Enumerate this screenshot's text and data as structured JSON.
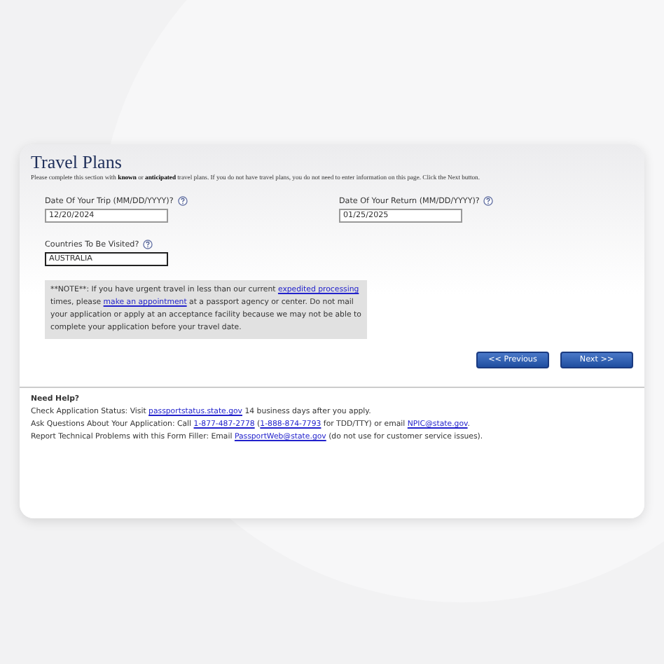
{
  "title": "Travel Plans",
  "description": "Please complete this section with **known** or **anticipated** travel plans. If you do not have travel plans, you do not need to enter information on this page. Click the Next button.",
  "date_fields": [
    {
      "label": "Date Of Your Trip (MM/DD/YYYY)?",
      "value": "12/20/2024"
    },
    {
      "label": "Date Of Your Return (MM/DD/YYYY)?",
      "value": "01/25/2025"
    }
  ],
  "countries_field": {
    "label": "Countries To Be Visited?",
    "value": "AUSTRALIA",
    "focused": true
  },
  "note": [
    {
      "kind": "text",
      "text": "**NOTE**: If you have urgent travel in less than our current "
    },
    {
      "kind": "link",
      "text": "expedited processing"
    },
    {
      "kind": "text",
      "text": " times, please "
    },
    {
      "kind": "link",
      "text": "make an appointment"
    },
    {
      "kind": "text",
      "text": " at a passport agency or center. Do not mail your application or apply at an acceptance facility because we may not be able to complete your application before your travel date."
    }
  ],
  "buttons": [
    "<< Previous",
    "Next >>"
  ],
  "help": {
    "title": "Need Help?",
    "lines": [
      [
        {
          "kind": "text",
          "text": "Check Application Status: Visit "
        },
        {
          "kind": "link",
          "text": "passportstatus.state.gov"
        },
        {
          "kind": "text",
          "text": " 14 business days after you apply."
        }
      ],
      [
        {
          "kind": "text",
          "text": "Ask Questions About Your Application: Call "
        },
        {
          "kind": "link",
          "text": "1-877-487-2778"
        },
        {
          "kind": "text",
          "text": " ("
        },
        {
          "kind": "link",
          "text": "1-888-874-7793"
        },
        {
          "kind": "text",
          "text": " for TDD/TTY) or email "
        },
        {
          "kind": "link",
          "text": "NPIC@state.gov"
        },
        {
          "kind": "text",
          "text": "."
        }
      ],
      [
        {
          "kind": "text",
          "text": "Report Technical Problems with this Form Filler: Email "
        },
        {
          "kind": "link",
          "text": "PassportWeb@state.gov"
        },
        {
          "kind": "text",
          "text": " (do not use for customer service issues)."
        }
      ]
    ]
  }
}
